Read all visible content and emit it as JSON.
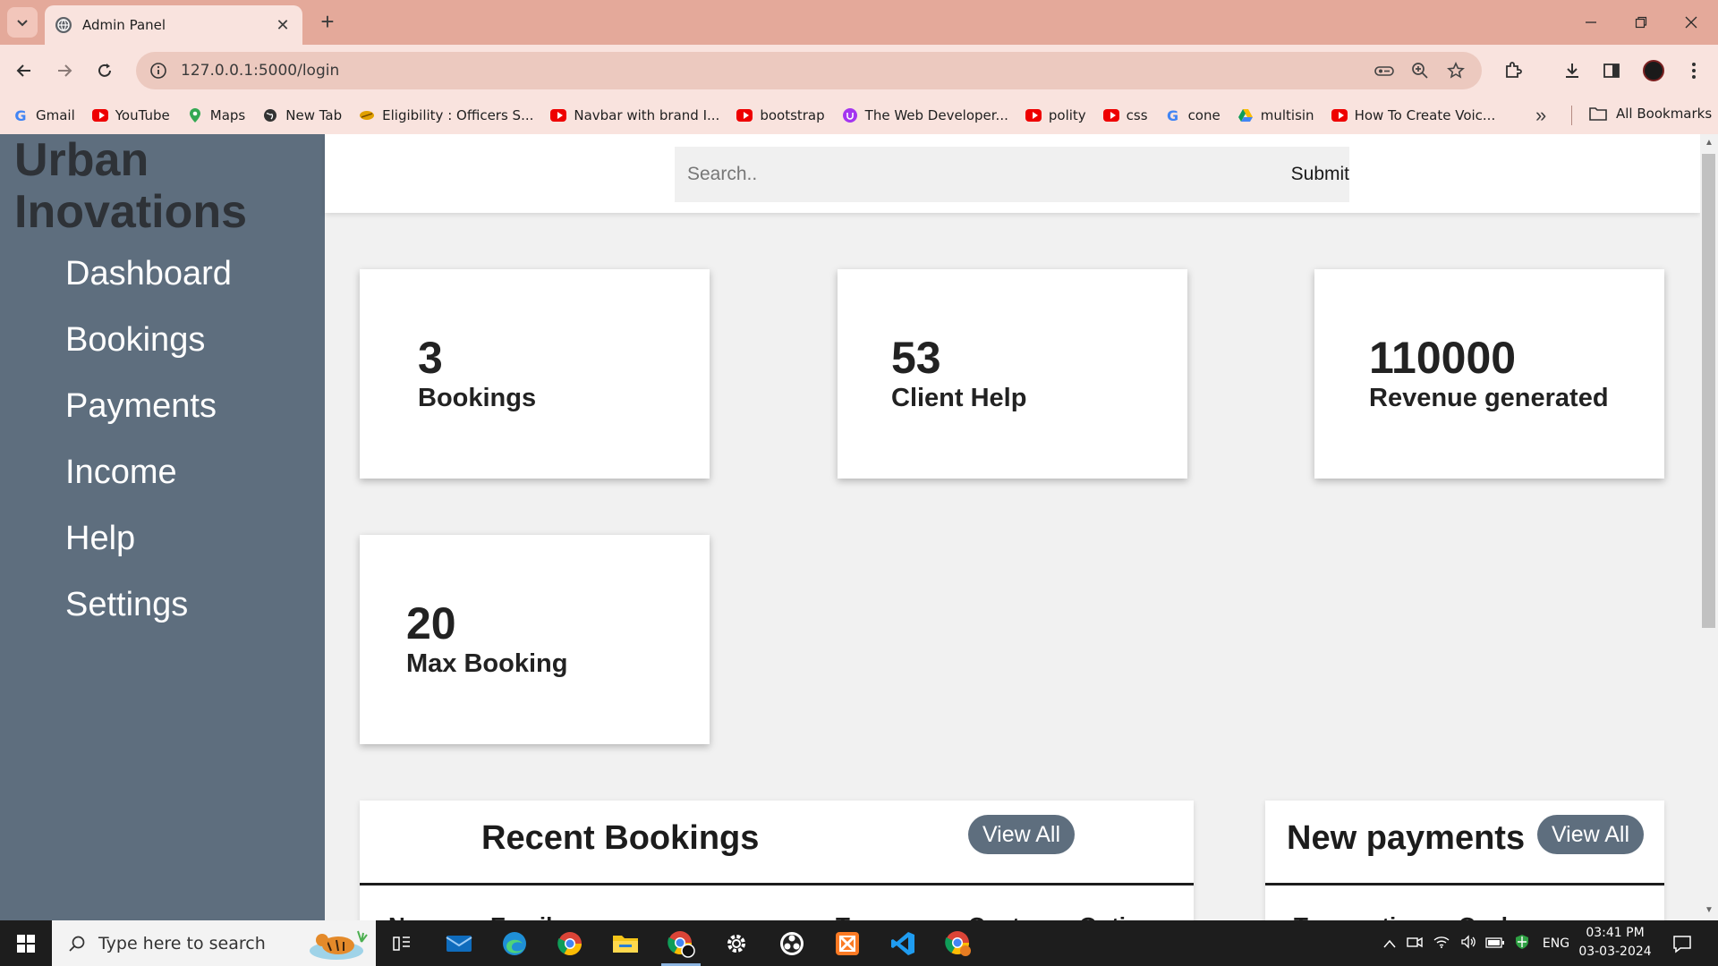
{
  "browser": {
    "tab_title": "Admin Panel",
    "url": "127.0.0.1:5000/login",
    "bookmarks": [
      {
        "label": "Gmail",
        "icon": "google-icon"
      },
      {
        "label": "YouTube",
        "icon": "youtube-icon"
      },
      {
        "label": "Maps",
        "icon": "maps-icon"
      },
      {
        "label": "New Tab",
        "icon": "globe-icon"
      },
      {
        "label": "Eligibility : Officers S...",
        "icon": "site-icon"
      },
      {
        "label": "Navbar with brand I...",
        "icon": "youtube-icon"
      },
      {
        "label": "bootstrap",
        "icon": "youtube-icon"
      },
      {
        "label": "The Web Developer...",
        "icon": "udemy-icon"
      },
      {
        "label": "polity",
        "icon": "youtube-icon"
      },
      {
        "label": "css",
        "icon": "youtube-icon"
      },
      {
        "label": "cone",
        "icon": "google-icon"
      },
      {
        "label": "multisin",
        "icon": "drive-icon"
      },
      {
        "label": "How To Create Voic...",
        "icon": "youtube-icon"
      }
    ],
    "all_bookmarks": "All Bookmarks"
  },
  "sidebar": {
    "brand_line1": "Urban",
    "brand_line2": "Inovations",
    "items": [
      {
        "label": "Dashboard"
      },
      {
        "label": "Bookings"
      },
      {
        "label": "Payments"
      },
      {
        "label": "Income"
      },
      {
        "label": "Help"
      },
      {
        "label": "Settings"
      }
    ]
  },
  "search": {
    "placeholder": "Search..",
    "submit_label": "Submit"
  },
  "cards": [
    {
      "value": "3",
      "label": "Bookings"
    },
    {
      "value": "53",
      "label": "Client Help"
    },
    {
      "value": "110000",
      "label": "Revenue generated"
    },
    {
      "value": "20",
      "label": "Max Booking"
    }
  ],
  "recent_bookings": {
    "title": "Recent Bookings",
    "view_all": "View All",
    "columns": [
      "Name",
      "Email",
      "Type",
      "Cost",
      "Option"
    ]
  },
  "new_payments": {
    "title": "New payments",
    "view_all": "View All",
    "columns": [
      "Transaction",
      "Cash"
    ]
  },
  "taskbar": {
    "search_placeholder": "Type here to search",
    "language": "ENG",
    "time": "03:41 PM",
    "date": "03-03-2024"
  },
  "colors": {
    "sidebar": "#5e6e7e",
    "browser_frame": "#e4a99a",
    "accent_button": "#5e6e7e"
  }
}
